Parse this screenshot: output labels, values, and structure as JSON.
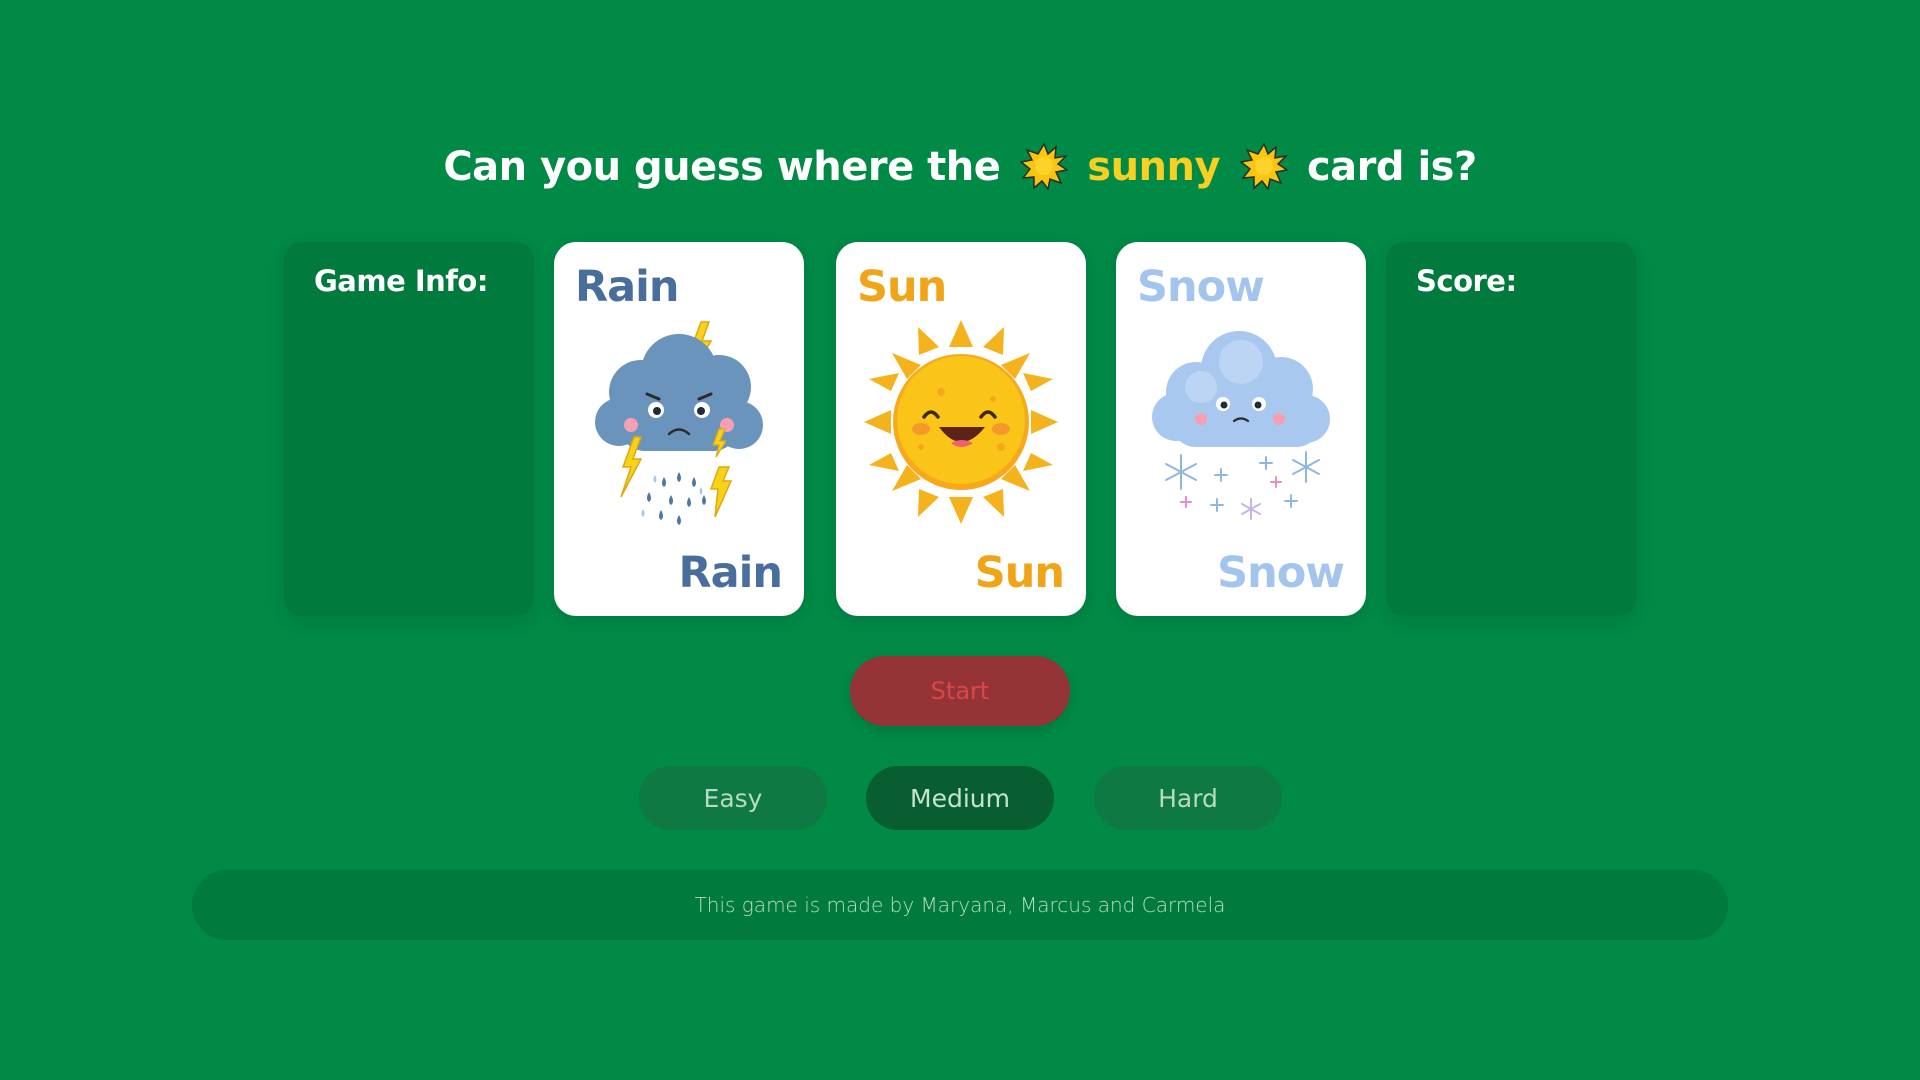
{
  "headline": {
    "before": "Can you guess where the",
    "highlight": "sunny",
    "after": "card is?",
    "highlight_color": "#f8cf23"
  },
  "panels": {
    "info_title": "Game Info:",
    "score_title": "Score:"
  },
  "cards": [
    {
      "label": "Rain",
      "color": "#4a6e9c",
      "icon": "storm-cloud-icon"
    },
    {
      "label": "Sun",
      "color": "#f0a418",
      "icon": "sun-icon"
    },
    {
      "label": "Snow",
      "color": "#a3c4ec",
      "icon": "snow-cloud-icon"
    }
  ],
  "controls": {
    "start_label": "Start",
    "levels": [
      "Easy",
      "Medium",
      "Hard"
    ],
    "selected_level": "Medium"
  },
  "footer": {
    "credit": "This game is made by Maryana, Marcus and Carmela"
  },
  "colors": {
    "background": "#018946",
    "panel": "#017a3e",
    "start_button": "#953436",
    "start_text": "#d84848"
  }
}
